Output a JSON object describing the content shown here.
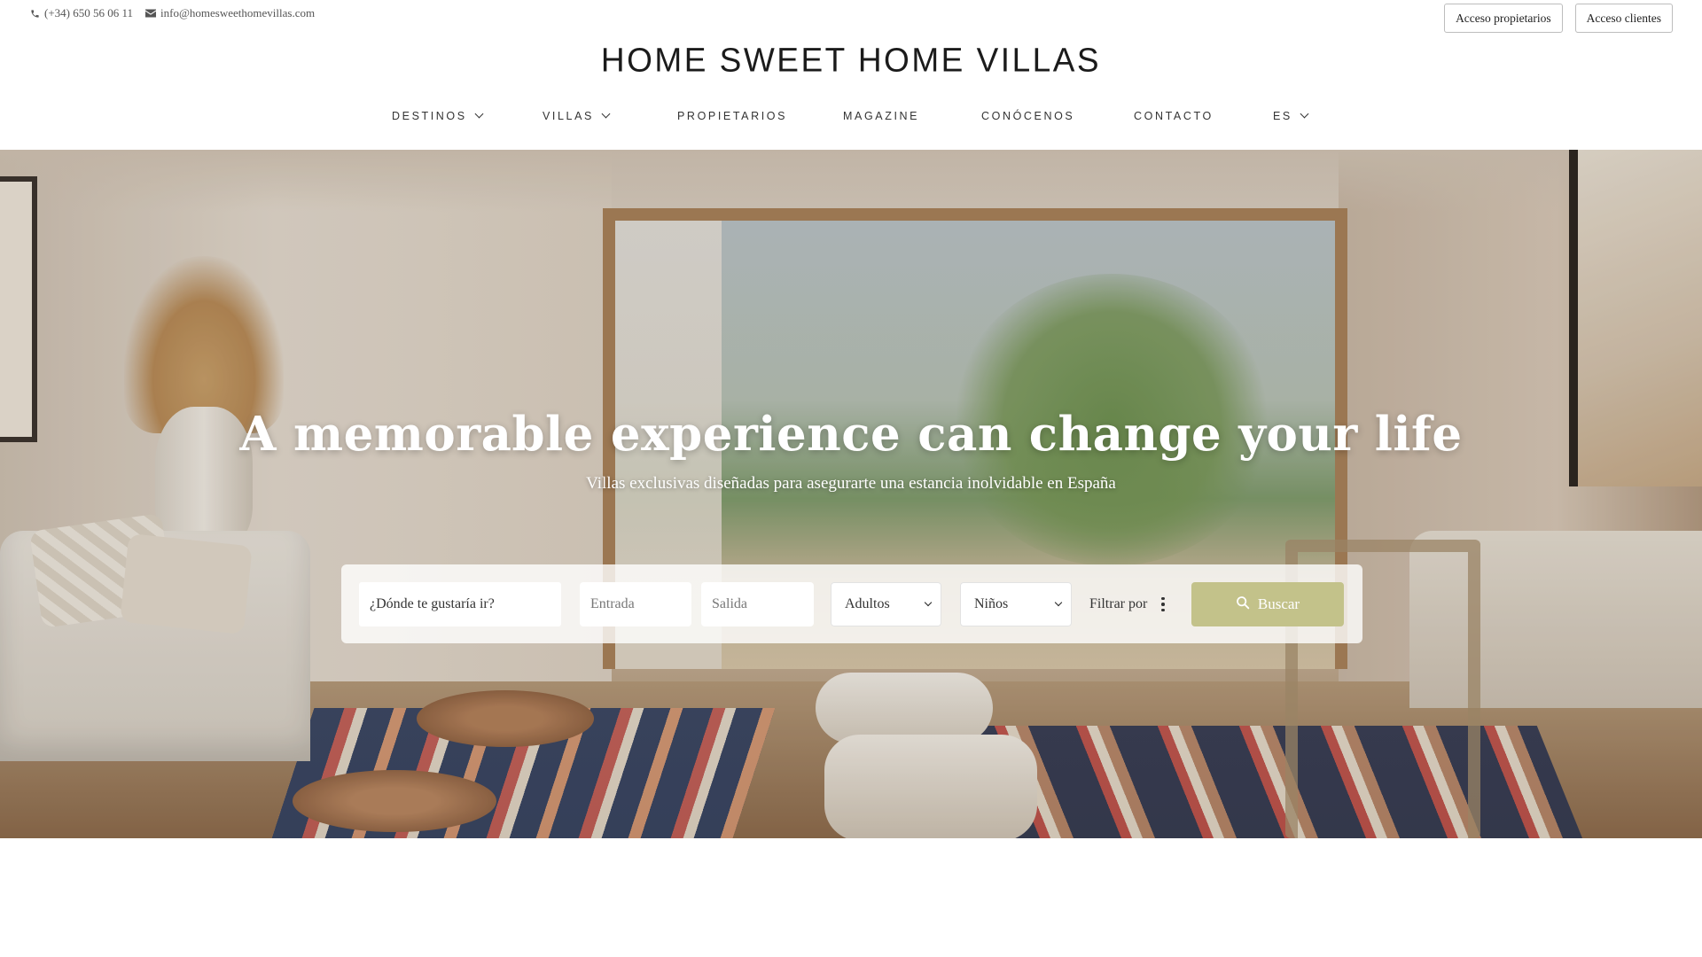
{
  "topbar": {
    "phone": "(+34) 650 56 06 11",
    "email": "info@homesweethomevillas.com",
    "owners_access": "Acceso propietarios",
    "clients_access": "Acceso clientes"
  },
  "logo": {
    "text": "HOME SWEET HOME VILLAS"
  },
  "nav": {
    "items": [
      {
        "label": "DESTINOS",
        "has_dropdown": true
      },
      {
        "label": "VILLAS",
        "has_dropdown": true
      },
      {
        "label": "PROPIETARIOS",
        "has_dropdown": false
      },
      {
        "label": "MAGAZINE",
        "has_dropdown": false
      },
      {
        "label": "CONÓCENOS",
        "has_dropdown": false
      },
      {
        "label": "CONTACTO",
        "has_dropdown": false
      },
      {
        "label": "ES",
        "has_dropdown": true
      }
    ]
  },
  "hero": {
    "title": "A memorable experience can change your life",
    "subtitle": "Villas exclusivas diseñadas para asegurarte una estancia inolvidable en España"
  },
  "search": {
    "destination_placeholder": "¿Dónde te gustaría ir?",
    "checkin_placeholder": "Entrada",
    "checkout_placeholder": "Salida",
    "adults_value": "Adultos",
    "children_value": "Niños",
    "filter_label": "Filtrar por",
    "submit_label": "Buscar"
  },
  "colors": {
    "accent_button": "#c3c28a",
    "text_dark": "#333333",
    "hero_text": "#ffffff"
  },
  "icons": {
    "phone": "phone-icon",
    "email": "envelope-icon",
    "dropdown": "chevron-down-icon",
    "filter": "vertical-dots-icon",
    "search": "search-icon"
  }
}
